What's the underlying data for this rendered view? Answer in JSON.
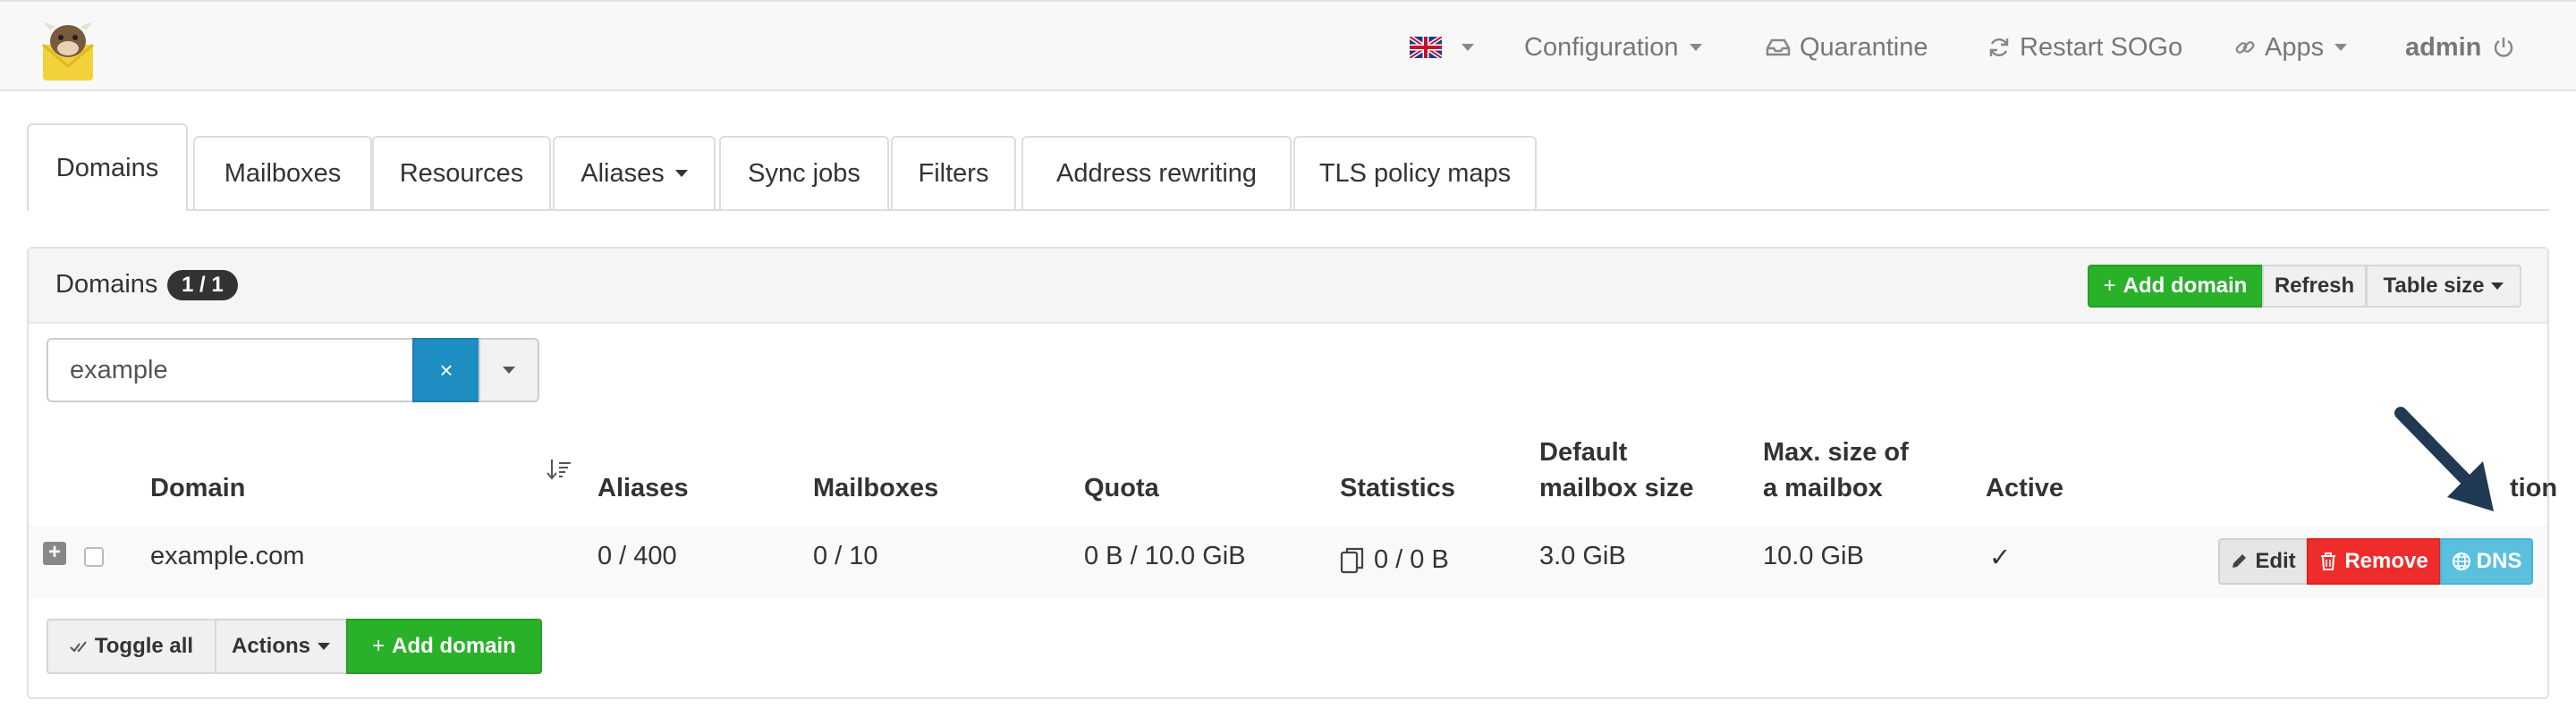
{
  "navbar": {
    "language_flag": "uk-flag-icon",
    "configuration": "Configuration",
    "quarantine": "Quarantine",
    "restart_sogo": "Restart SOGo",
    "apps": "Apps",
    "admin": "admin"
  },
  "tabs": [
    {
      "label": "Domains"
    },
    {
      "label": "Mailboxes"
    },
    {
      "label": "Resources"
    },
    {
      "label": "Aliases"
    },
    {
      "label": "Sync jobs"
    },
    {
      "label": "Filters"
    },
    {
      "label": "Address rewriting"
    },
    {
      "label": "TLS policy maps"
    }
  ],
  "panel": {
    "title": "Domains",
    "badge": "1 / 1",
    "add_domain": "Add domain",
    "refresh": "Refresh",
    "table_size": "Table size"
  },
  "search": {
    "value": "example",
    "clear": "×"
  },
  "table": {
    "headers": {
      "domain": "Domain",
      "aliases": "Aliases",
      "mailboxes": "Mailboxes",
      "quota": "Quota",
      "statistics": "Statistics",
      "default_size_1": "Default",
      "default_size_2": "mailbox size",
      "max_size_1": "Max. size of",
      "max_size_2": "a mailbox",
      "active": "Active",
      "action": "tion"
    },
    "rows": [
      {
        "domain": "example.com",
        "aliases": "0 / 400",
        "mailboxes": "0 / 10",
        "quota": "0 B / 10.0 GiB",
        "statistics": "0 / 0 B",
        "default_size": "3.0 GiB",
        "max_size": "10.0 GiB",
        "active": "✓",
        "edit": "Edit",
        "remove": "Remove",
        "dns": "DNS"
      }
    ]
  },
  "footer": {
    "toggle_all": "Toggle all",
    "actions": "Actions",
    "add_domain": "Add domain"
  },
  "colors": {
    "green": "#2ab12a",
    "red": "#ef2c2c",
    "blue": "#5bc0de",
    "search_blue": "#1e8dc2",
    "arrow": "#1f3a52"
  }
}
